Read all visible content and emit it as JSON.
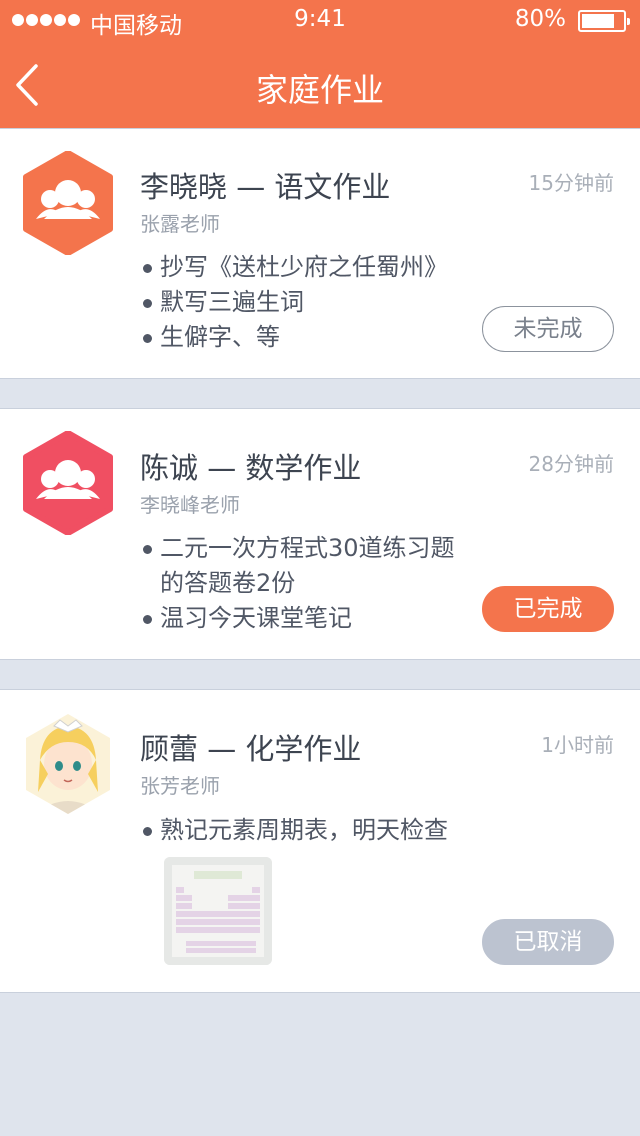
{
  "status_bar": {
    "carrier": "中国移动",
    "time": "9:41",
    "battery": "80%",
    "battery_level": 0.8
  },
  "nav": {
    "title": "家庭作业",
    "back_icon": "chevron-left-icon"
  },
  "colors": {
    "accent": "#f4744c",
    "red": "#f04f62",
    "cancel": "#bcc3d0",
    "background": "#dfe4ed"
  },
  "homeworks": [
    {
      "title": "李晓晓 — 语文作业",
      "teacher": "张露老师",
      "time_ago": "15分钟前",
      "tasks": [
        "抄写《送杜少府之任蜀州》",
        "默写三遍生词",
        "生僻字、等"
      ],
      "status": "未完成",
      "avatar_icon": "group-icon",
      "avatar_color": "#f4744c"
    },
    {
      "title": "陈诚 — 数学作业",
      "teacher": "李晓峰老师",
      "time_ago": "28分钟前",
      "tasks": [
        "二元一次方程式30道练习题的答题卷2份",
        "温习今天课堂笔记"
      ],
      "status": "已完成",
      "avatar_icon": "group-icon",
      "avatar_color": "#f04f62"
    },
    {
      "title": "顾蕾 — 化学作业",
      "teacher": "张芳老师",
      "time_ago": "1小时前",
      "tasks": [
        "熟记元素周期表，明天检查"
      ],
      "status": "已取消",
      "avatar_icon": "user-photo",
      "attachment": "periodic-table-photo"
    }
  ]
}
